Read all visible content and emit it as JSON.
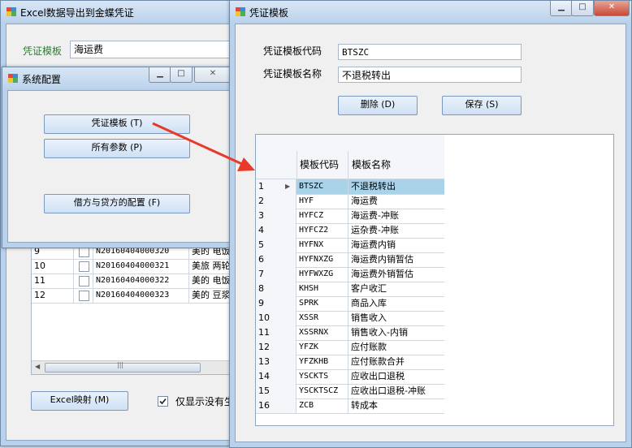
{
  "back_window": {
    "title": "Excel数据导出到金蝶凭证",
    "template_label": "凭证模板",
    "template_value": "海运费",
    "rows": [
      {
        "n": "9",
        "code": "N20160404000320",
        "desc": "美的 电饭煲"
      },
      {
        "n": "10",
        "code": "N20160404000321",
        "desc": "美旅 两轮拉"
      },
      {
        "n": "11",
        "code": "N20160404000322",
        "desc": "美的 电饭煲"
      },
      {
        "n": "12",
        "code": "N20160404000323",
        "desc": "美的 豆浆机"
      }
    ],
    "scroll_mark": "|||",
    "excel_button": "Excel映射 (M)",
    "only_show_label": "仅显示没有生"
  },
  "config_window": {
    "title": "系统配置",
    "voucher_button": "凭证模板 (T)",
    "params_button": "所有参数 (P)",
    "debit_credit_button": "借方与贷方的配置 (F)"
  },
  "template_window": {
    "title": "凭证模板",
    "code_label": "凭证模板代码",
    "code_value": "BTSZC",
    "name_label": "凭证模板名称",
    "name_value": "不退税转出",
    "delete_button": "删除 (D)",
    "save_button": "保存 (S)",
    "columns": [
      "模板代码",
      "模板名称"
    ],
    "rows": [
      {
        "n": "1",
        "code": "BTSZC",
        "name": "不退税转出"
      },
      {
        "n": "2",
        "code": "HYF",
        "name": "海运费"
      },
      {
        "n": "3",
        "code": "HYFCZ",
        "name": "海运费-冲账"
      },
      {
        "n": "4",
        "code": "HYFCZ2",
        "name": "运杂费-冲账"
      },
      {
        "n": "5",
        "code": "HYFNX",
        "name": "海运费内销"
      },
      {
        "n": "6",
        "code": "HYFNXZG",
        "name": "海运费内销暂估"
      },
      {
        "n": "7",
        "code": "HYFWXZG",
        "name": "海运费外销暂估"
      },
      {
        "n": "8",
        "code": "KHSH",
        "name": "客户收汇"
      },
      {
        "n": "9",
        "code": "SPRK",
        "name": "商品入库"
      },
      {
        "n": "10",
        "code": "XSSR",
        "name": "销售收入"
      },
      {
        "n": "11",
        "code": "XSSRNX",
        "name": "销售收入-内销"
      },
      {
        "n": "12",
        "code": "YFZK",
        "name": "应付账款"
      },
      {
        "n": "13",
        "code": "YFZKHB",
        "name": "应付账款合并"
      },
      {
        "n": "14",
        "code": "YSCKTS",
        "name": "应收出口退税"
      },
      {
        "n": "15",
        "code": "YSCKTSCZ",
        "name": "应收出口退税-冲账"
      },
      {
        "n": "16",
        "code": "ZCB",
        "name": "转成本"
      }
    ]
  },
  "colors": {
    "selected_row": "#a9d3e9",
    "arrow": "#e8392b",
    "label_green": "#2e7d32"
  }
}
